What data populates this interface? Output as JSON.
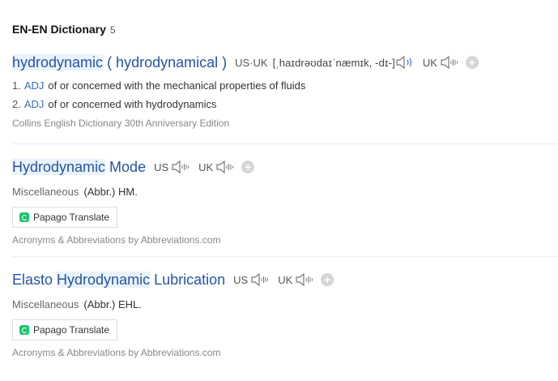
{
  "section": {
    "title": "EN-EN Dictionary",
    "count": "5"
  },
  "entries": [
    {
      "head_pre": "",
      "head_hl": "hydrodynamic",
      "head_post": " ( hydrodynamical )",
      "pron": {
        "us_uk_label": "US·UK",
        "ipa": "[ˌhaɪdrəʊdaɪˈnæmɪk, -dɪ-]",
        "uk_label": "UK"
      },
      "meanings": [
        {
          "num": "1.",
          "pos": "ADJ",
          "text": "of or concerned with the mechanical properties of fluids"
        },
        {
          "num": "2.",
          "pos": "ADJ",
          "text": "of or concerned with hydrodynamics"
        }
      ],
      "source": "Collins English Dictionary 30th Anniversary Edition"
    },
    {
      "head_pre": "",
      "head_hl": "Hydrodynamic",
      "head_post": " Mode",
      "pron": {
        "us_label": "US",
        "uk_label": "UK"
      },
      "category": "Miscellaneous",
      "meaning": "(Abbr.) HM.",
      "papago_label": "Papago Translate",
      "source": "Acronyms & Abbreviations by Abbreviations.com"
    },
    {
      "head_pre": "Elasto ",
      "head_hl": "Hydrodynamic",
      "head_post": " Lubrication",
      "pron": {
        "us_label": "US",
        "uk_label": "UK"
      },
      "category": "Miscellaneous",
      "meaning": "(Abbr.) EHL.",
      "papago_label": "Papago Translate",
      "source": "Acronyms & Abbreviations by Abbreviations.com"
    }
  ],
  "icons": {
    "speaker": "speaker-icon",
    "add": "add-wordbook-icon",
    "papago": "papago-logo-icon"
  },
  "colors": {
    "headword": "#2554a4",
    "pos": "#3b6fb6",
    "highlight": "#eaf3fb",
    "papago": "#1fc46e"
  }
}
